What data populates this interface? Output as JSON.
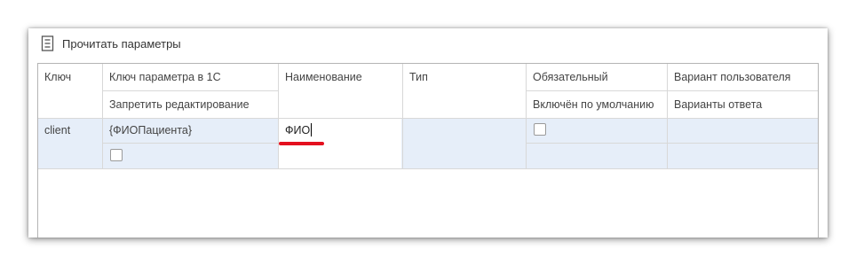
{
  "toolbar": {
    "read_params_label": "Прочитать параметры",
    "read_params_icon": "document-icon"
  },
  "table": {
    "headers": {
      "key": "Ключ",
      "param_key_1c": "Ключ параметра в 1С",
      "forbid_editing": "Запретить редактирование",
      "name": "Наименование",
      "type": "Тип",
      "required": "Обязательный",
      "enabled_by_default": "Включён по умолчанию",
      "user_variant": "Вариант пользователя",
      "answer_variants": "Варианты ответа"
    },
    "rows": [
      {
        "key": "client",
        "param_key_1c": "{ФИОПациента}",
        "forbid_editing": false,
        "name": "ФИО",
        "type": "",
        "required": false,
        "enabled_by_default": "",
        "user_variant": "",
        "answer_variants": ""
      }
    ]
  },
  "colors": {
    "selected_row": "#e6eef9",
    "annotation_underline": "#e4101e",
    "grid_border": "#b4b4b4"
  }
}
